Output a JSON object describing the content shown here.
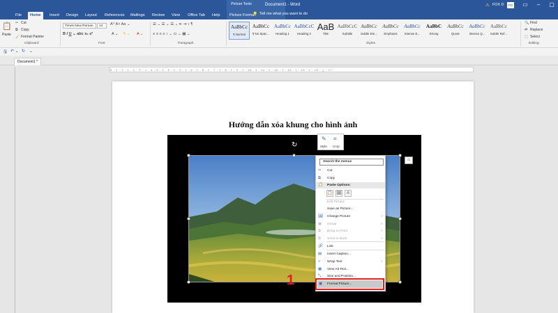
{
  "window": {
    "contextual_group": "Picture Tools",
    "doc_title": "Document1 - Word",
    "user": "FOX D",
    "avatar": "FD",
    "tell_me": "Tell me what you want to do",
    "controls": [
      "ribbon-options-icon",
      "minimize-icon",
      "maximize-icon"
    ]
  },
  "tabs": [
    "File",
    "Home",
    "Insert",
    "Design",
    "Layout",
    "References",
    "Mailings",
    "Review",
    "View",
    "Office Tab",
    "Help",
    "Picture Format"
  ],
  "ribbon": {
    "clipboard": {
      "paste": "Paste",
      "cut": "Cut",
      "copy": "Copy",
      "format_painter": "Format Painter",
      "label": "Clipboard"
    },
    "font": {
      "name": "Times New Roman",
      "size": "14",
      "label": "Font"
    },
    "paragraph": {
      "label": "Paragraph"
    },
    "styles": {
      "label": "Styles",
      "items": [
        {
          "sample": "AaBbCc",
          "name": "¶ Normal"
        },
        {
          "sample": "AaBbCc",
          "name": "¶ No Spac..."
        },
        {
          "sample": "AaBbCc",
          "name": "Heading 1"
        },
        {
          "sample": "AaBbCcC",
          "name": "Heading 2"
        },
        {
          "sample": "AaB",
          "name": "Title"
        },
        {
          "sample": "AaBbCcC",
          "name": "Subtitle"
        },
        {
          "sample": "AaBbCc",
          "name": "Subtle Em..."
        },
        {
          "sample": "AaBbCc",
          "name": "Emphasis"
        },
        {
          "sample": "AaBbCc",
          "name": "Intense E..."
        },
        {
          "sample": "AaBbC",
          "name": "Strong"
        },
        {
          "sample": "AaBbCc",
          "name": "Quote"
        },
        {
          "sample": "AaBbCc",
          "name": "Intense Q..."
        },
        {
          "sample": "AaBbCc",
          "name": "Subtle Ref..."
        }
      ]
    },
    "editing": {
      "find": "Find",
      "replace": "Replace",
      "select": "Select",
      "label": "Editing"
    }
  },
  "doc_tab": "Document1 *",
  "ruler": "3 · 1 · 2 · 1 · 1 · ▽ · 1 · 1 · 2 · 1 · 3 · 1 · 4 · 1 · 5 · 1 · 6 · 1 · 7 · 1 · 8 · 1 · 9 · 1 · 10 · 1 · 11 · 1 · 12 · 1 · 13 · 1 · 14 · 1 · 15 · △ · 17 ·",
  "document": {
    "heading": "Hướng dẫn xóa khung cho hình ảnh"
  },
  "mini_toolbar": {
    "style": "Style",
    "crop": "Crop"
  },
  "context_menu": {
    "search_placeholder": "Search the menus",
    "items": [
      {
        "label": "Cut",
        "icon": "scissors-icon",
        "disabled": false
      },
      {
        "label": "Copy",
        "icon": "copy-icon",
        "disabled": false
      },
      {
        "label": "Paste Options:",
        "icon": "paste-icon",
        "disabled": false
      },
      {
        "label": "Edit Picture",
        "icon": "",
        "disabled": true
      },
      {
        "label": "Save as Picture...",
        "icon": "",
        "disabled": false
      },
      {
        "label": "Change Picture",
        "icon": "change-picture-icon",
        "disabled": false
      },
      {
        "label": "Group",
        "icon": "group-icon",
        "disabled": true
      },
      {
        "label": "Bring to Front",
        "icon": "bring-front-icon",
        "disabled": true
      },
      {
        "label": "Send to Back",
        "icon": "send-back-icon",
        "disabled": true
      },
      {
        "label": "Link",
        "icon": "link-icon",
        "disabled": false
      },
      {
        "label": "Insert Caption...",
        "icon": "caption-icon",
        "disabled": false
      },
      {
        "label": "Wrap Text",
        "icon": "wrap-text-icon",
        "disabled": false
      },
      {
        "label": "View Alt Text...",
        "icon": "alt-text-icon",
        "disabled": false
      },
      {
        "label": "Size and Position...",
        "icon": "size-position-icon",
        "disabled": false
      }
    ],
    "format_picture": "Format Picture..."
  },
  "step_number": "1",
  "colors": {
    "accent": "#2b579a",
    "highlight": "#e02020"
  }
}
